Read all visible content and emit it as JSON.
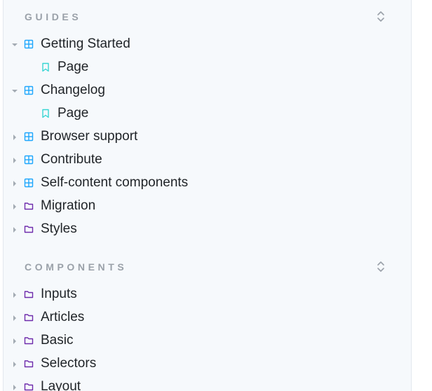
{
  "sections": {
    "guides": {
      "title": "GUIDES",
      "items": [
        {
          "label": "Getting Started",
          "icon": "grid-icon",
          "expanded": true
        },
        {
          "label": "Page",
          "icon": "bookmark-icon",
          "child": true
        },
        {
          "label": "Changelog",
          "icon": "grid-icon",
          "expanded": true
        },
        {
          "label": "Page",
          "icon": "bookmark-icon",
          "child": true
        },
        {
          "label": "Browser support",
          "icon": "grid-icon",
          "expanded": false
        },
        {
          "label": "Contribute",
          "icon": "grid-icon",
          "expanded": false
        },
        {
          "label": "Self-content components",
          "icon": "grid-icon",
          "expanded": false
        },
        {
          "label": "Migration",
          "icon": "folder-icon",
          "expanded": false
        },
        {
          "label": "Styles",
          "icon": "folder-icon",
          "expanded": false
        }
      ]
    },
    "components": {
      "title": "COMPONENTS",
      "items": [
        {
          "label": "Inputs",
          "icon": "folder-icon",
          "expanded": false
        },
        {
          "label": "Articles",
          "icon": "folder-icon",
          "expanded": false
        },
        {
          "label": "Basic",
          "icon": "folder-icon",
          "expanded": false
        },
        {
          "label": "Selectors",
          "icon": "folder-icon",
          "expanded": false
        },
        {
          "label": "Layout",
          "icon": "folder-icon",
          "expanded": false
        }
      ]
    }
  },
  "colors": {
    "grid_icon": "#1ea7fd",
    "bookmark_icon": "#37d5d3",
    "folder_icon": "#6f2cac",
    "caret": "#a3abb3",
    "section_title": "#9aa1a9",
    "panel_background": "#f6f9fc"
  }
}
